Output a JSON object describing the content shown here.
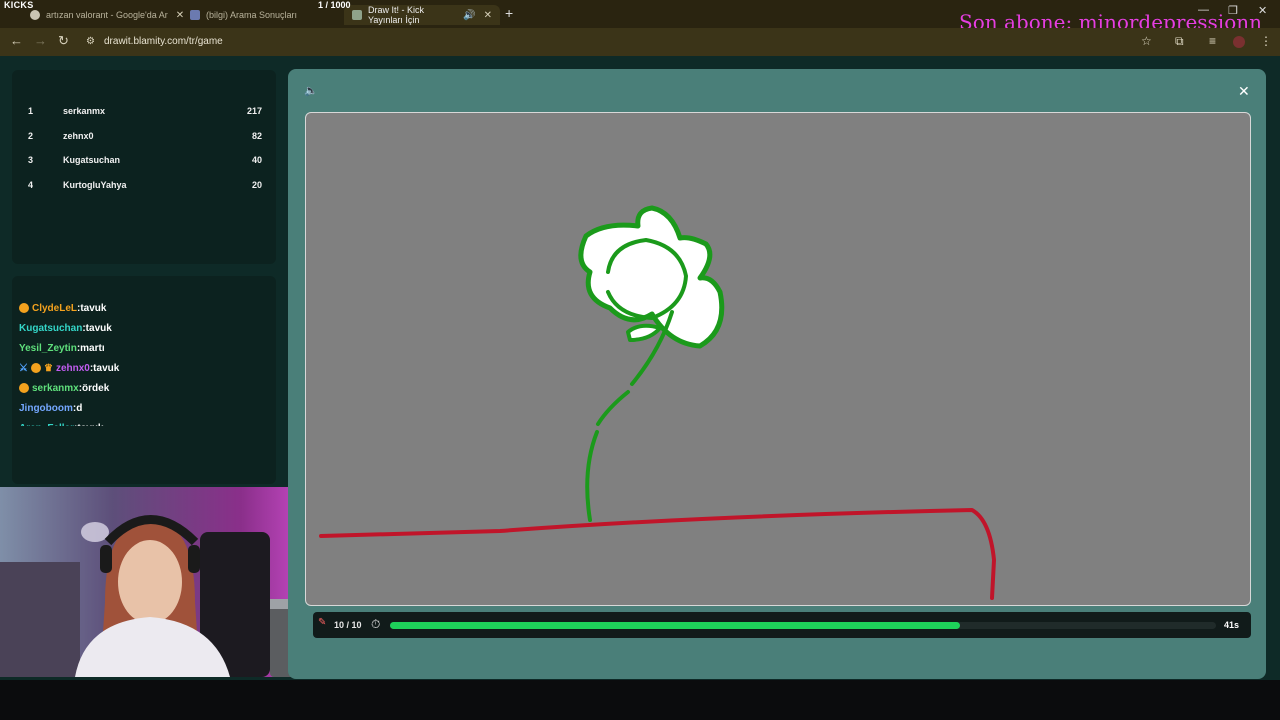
{
  "overlay": {
    "channel": "KICKS",
    "counter": "1  / 1000",
    "last_sub": "Son abone: minordepressionn"
  },
  "browser": {
    "tabs": [
      {
        "label": "artızan valorant - Google'da Ar",
        "active": false
      },
      {
        "label": "(bilgi) Arama Sonuçları",
        "active": false
      },
      {
        "label": "Draw It! - Kick Yayınları İçin",
        "active": true
      }
    ],
    "url": "drawit.blamity.com/tr/game",
    "new_tab": "+"
  },
  "leaderboard": [
    {
      "rank": "1",
      "name": "serkanmx",
      "score": "217"
    },
    {
      "rank": "2",
      "name": "zehnx0",
      "score": "82"
    },
    {
      "rank": "3",
      "name": "Kugatsuchan",
      "score": "40"
    },
    {
      "rank": "4",
      "name": "KurtogluYahya",
      "score": "20"
    }
  ],
  "chat": [
    {
      "user": "ClydeLeL",
      "color": "#f4a21e",
      "badges": [
        "sub"
      ],
      "message": ":tavuk"
    },
    {
      "user": "Kugatsuchan",
      "color": "#34d6c8",
      "badges": [],
      "message": ":tavuk"
    },
    {
      "user": "Yesil_Zeytin",
      "color": "#5fe07c",
      "badges": [],
      "message": ":martı"
    },
    {
      "user": "zehnx0",
      "color": "#c15cf0",
      "badges": [
        "sword",
        "sub",
        "crown"
      ],
      "message": ":tavuk"
    },
    {
      "user": "serkanmx",
      "color": "#5fe07c",
      "badges": [
        "sub"
      ],
      "message": ":ördek"
    },
    {
      "user": "Jingoboom",
      "color": "#74a7ff",
      "badges": [],
      "message": ":d"
    },
    {
      "user": "Aren_Feller",
      "color": "#34d6c8",
      "badges": [],
      "message": ":tavuk"
    }
  ],
  "game": {
    "rounds": "10 / 10",
    "time_left": "41s",
    "progress_fraction": 0.69
  },
  "colors": {
    "progress": "#1ed15a",
    "stem": "#1b9a1b",
    "ground": "#c0152a",
    "overlay_text": "#e53ee0"
  }
}
